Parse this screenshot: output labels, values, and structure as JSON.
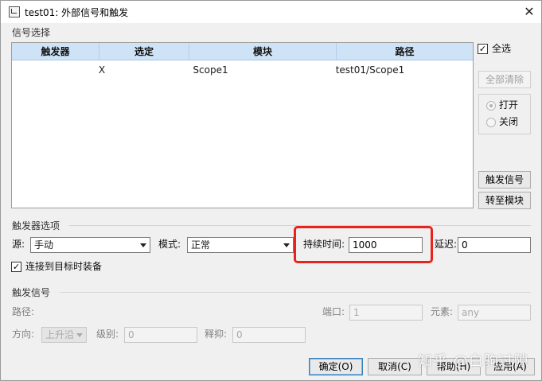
{
  "window": {
    "title": "test01: 外部信号和触发",
    "close_glyph": "✕"
  },
  "signal_selection": {
    "group_label": "信号选择",
    "columns": [
      "触发器",
      "选定",
      "模块",
      "路径"
    ],
    "rows": [
      {
        "trigger": "",
        "selected": "X",
        "block": "Scope1",
        "path": "test01/Scope1"
      }
    ],
    "select_all": {
      "label": "全选",
      "checked": true
    },
    "clear_all_label": "全部清除",
    "radio_on_label": "打开",
    "radio_off_label": "关闭",
    "trigger_signal_label": "触发信号",
    "goto_block_label": "转至模块"
  },
  "trigger_options": {
    "group_label": "触发器选项",
    "source_label": "源:",
    "source_value": "手动",
    "mode_label": "模式:",
    "mode_value": "正常",
    "duration_label": "持续时间:",
    "duration_value": "1000",
    "delay_label": "延迟:",
    "delay_value": "0",
    "arm_label": "连接到目标时装备",
    "arm_checked": true
  },
  "trigger_signal": {
    "group_label": "触发信号",
    "path_label": "路径:",
    "port_label": "端口:",
    "port_value": "1",
    "element_label": "元素:",
    "element_value": "any",
    "direction_label": "方向:",
    "direction_value": "上升沿",
    "level_label": "级别:",
    "level_value": "0",
    "holdoff_label": "释抑:",
    "holdoff_value": "0"
  },
  "footer": {
    "ok_label": "确定(O)",
    "cancel_label": "取消(C)",
    "help_label": "帮助(H)",
    "apply_label": "应用(A)"
  },
  "watermark": "知乎 @白驹过隙",
  "colors": {
    "header_bg": "#cfe3f6",
    "highlight": "#e8231b"
  }
}
